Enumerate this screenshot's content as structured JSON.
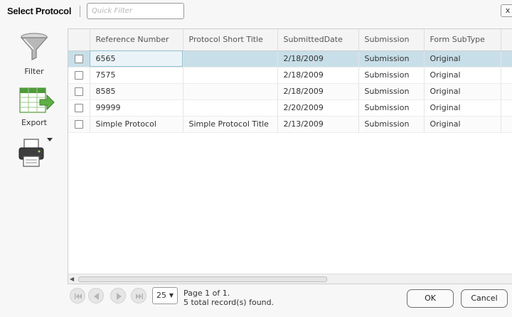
{
  "dialog": {
    "title": "Select Protocol",
    "quick_filter_placeholder": "Quick Filter",
    "close_label": "x"
  },
  "toolbar": {
    "filter_label": "Filter",
    "export_label": "Export",
    "print_icon": "printer-icon",
    "print_dropdown_icon": "dropdown-arrow-icon"
  },
  "grid": {
    "columns": [
      "Reference Number",
      "Protocol Short Title",
      "SubmittedDate",
      "Submission",
      "Form SubType"
    ],
    "rows": [
      {
        "reference": "6565",
        "title": "",
        "date": "2/18/2009",
        "submission": "Submission",
        "subtype": "Original"
      },
      {
        "reference": "7575",
        "title": "",
        "date": "2/18/2009",
        "submission": "Submission",
        "subtype": "Original"
      },
      {
        "reference": "8585",
        "title": "",
        "date": "2/18/2009",
        "submission": "Submission",
        "subtype": "Original"
      },
      {
        "reference": "99999",
        "title": "",
        "date": "2/20/2009",
        "submission": "Submission",
        "subtype": "Original"
      },
      {
        "reference": "Simple Protocol",
        "title": "Simple Protocol Title",
        "date": "2/13/2009",
        "submission": "Submission",
        "subtype": "Original"
      }
    ],
    "selected_row": 0
  },
  "pager": {
    "page_size": "25",
    "page_text": "Page 1 of 1.",
    "records_text": "5 total record(s) found."
  },
  "buttons": {
    "ok": "OK",
    "cancel": "Cancel"
  },
  "colors": {
    "selected_row": "#c8dfe9",
    "filter_gray": "#8f8f8f",
    "export_green": "#4f9a3a"
  }
}
